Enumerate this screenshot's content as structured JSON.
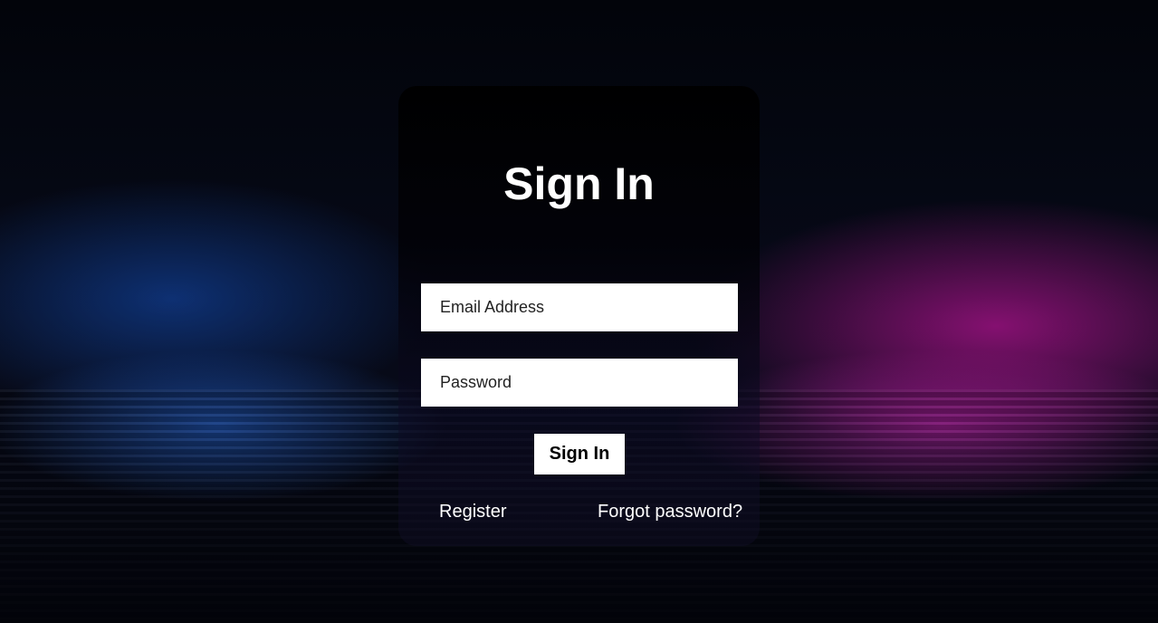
{
  "page": {
    "title": "Sign In"
  },
  "form": {
    "email_placeholder": "Email Address",
    "password_placeholder": "Password",
    "submit_label": "Sign In"
  },
  "links": {
    "register": "Register",
    "forgot_password": "Forgot password?"
  },
  "colors": {
    "background": "#05060b",
    "card": "#000000",
    "field": "#ffffff",
    "text_on_dark": "#ffffff",
    "accent_left": "#1450be",
    "accent_right": "#c814a0"
  }
}
